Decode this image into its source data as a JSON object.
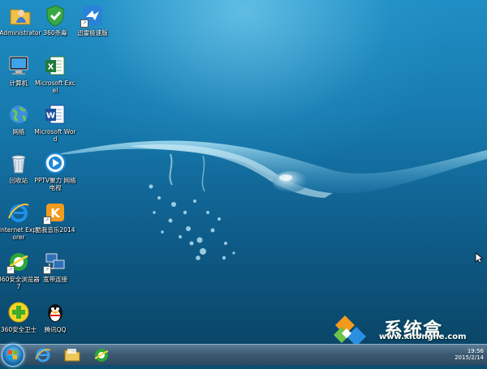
{
  "desktop": {
    "icons": [
      {
        "label": "Administrator",
        "icon": "user-folder-icon"
      },
      {
        "label": "360杀毒",
        "icon": "360-antivirus-shield-icon"
      },
      {
        "label": "迅雷极速版",
        "icon": "xunlei-bird-icon"
      },
      {
        "label": "计算机",
        "icon": "computer-icon"
      },
      {
        "label": "Microsoft Excel",
        "icon": "excel-icon"
      },
      {
        "label": "网络",
        "icon": "network-globe-icon"
      },
      {
        "label": "Microsoft Word",
        "icon": "word-icon"
      },
      {
        "label": "回收站",
        "icon": "recycle-bin-icon"
      },
      {
        "label": "PPTV聚力 网络电视",
        "icon": "pptv-icon"
      },
      {
        "label": "Internet Explorer",
        "icon": "internet-explorer-icon"
      },
      {
        "label": "酷我音乐2014",
        "icon": "kuwo-music-icon"
      },
      {
        "label": "360安全浏览器7",
        "icon": "360-browser-icon"
      },
      {
        "label": "宽带连接",
        "icon": "broadband-connection-icon"
      },
      {
        "label": "360安全卫士",
        "icon": "360-safeguard-icon"
      },
      {
        "label": "腾讯QQ",
        "icon": "qq-penguin-icon"
      }
    ]
  },
  "watermark": {
    "brand": "系统盒",
    "url": "www.xitonghe.com"
  },
  "taskbar": {
    "start": "windows-start-orb-icon",
    "pinned": [
      "internet-explorer-icon",
      "file-explorer-folder-icon",
      "360-browser-icon"
    ],
    "clock_time": "19:56",
    "clock_date": "2015/2/14"
  },
  "colors": {
    "wallpaper_top": "#1f8ec4",
    "wallpaper_bottom": "#0a4668",
    "taskbar": "#3c5b73"
  }
}
